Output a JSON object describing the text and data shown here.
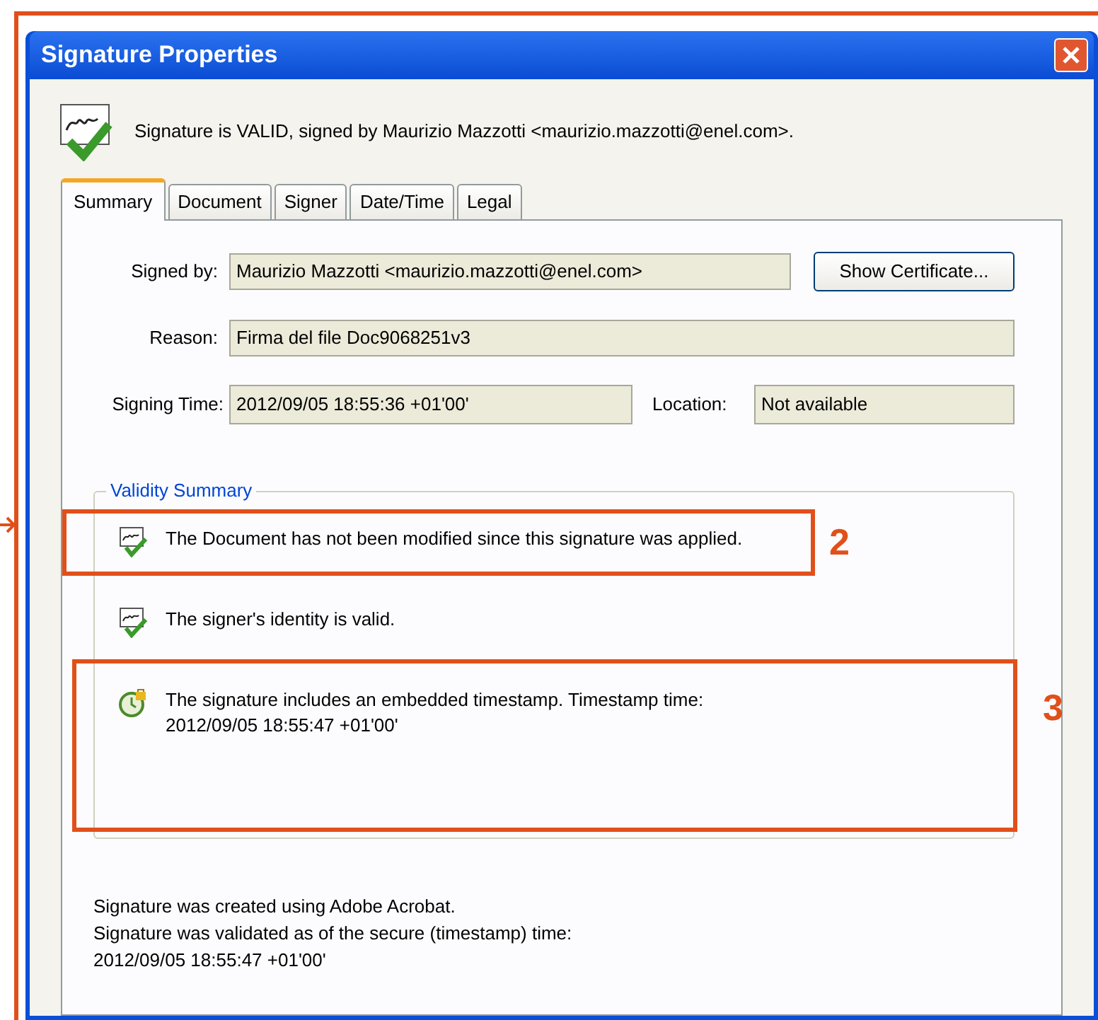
{
  "window": {
    "title": "Signature Properties"
  },
  "header": "Signature is VALID, signed by Maurizio Mazzotti <maurizio.mazzotti@enel.com>.",
  "tabs": [
    {
      "label": "Summary",
      "selected": true
    },
    {
      "label": "Document",
      "selected": false
    },
    {
      "label": "Signer",
      "selected": false
    },
    {
      "label": "Date/Time",
      "selected": false
    },
    {
      "label": "Legal",
      "selected": false
    }
  ],
  "fields": {
    "signed_by": {
      "label": "Signed by:",
      "value": "Maurizio Mazzotti <maurizio.mazzotti@enel.com>"
    },
    "show_certificate": "Show Certificate...",
    "reason": {
      "label": "Reason:",
      "value": "Firma del file Doc9068251v3"
    },
    "signing_time": {
      "label": "Signing Time:",
      "value": "2012/09/05 18:55:36 +01'00'"
    },
    "location": {
      "label": "Location:",
      "value": "Not available"
    }
  },
  "validity_summary": {
    "title": "Validity Summary",
    "items": [
      {
        "kind": "check",
        "text": "The Document has not been modified since this signature was applied."
      },
      {
        "kind": "check",
        "text": "The signer's identity is valid."
      },
      {
        "kind": "timestamp",
        "text": "The signature includes an embedded timestamp. Timestamp time:",
        "detail": "2012/09/05 18:55:47 +01'00'"
      }
    ]
  },
  "footer": [
    "Signature was created using Adobe Acrobat.",
    "Signature was validated as of the secure (timestamp) time:",
    "2012/09/05 18:55:47 +01'00'"
  ],
  "annotations": [
    {
      "label": "2"
    },
    {
      "label": "3"
    }
  ]
}
